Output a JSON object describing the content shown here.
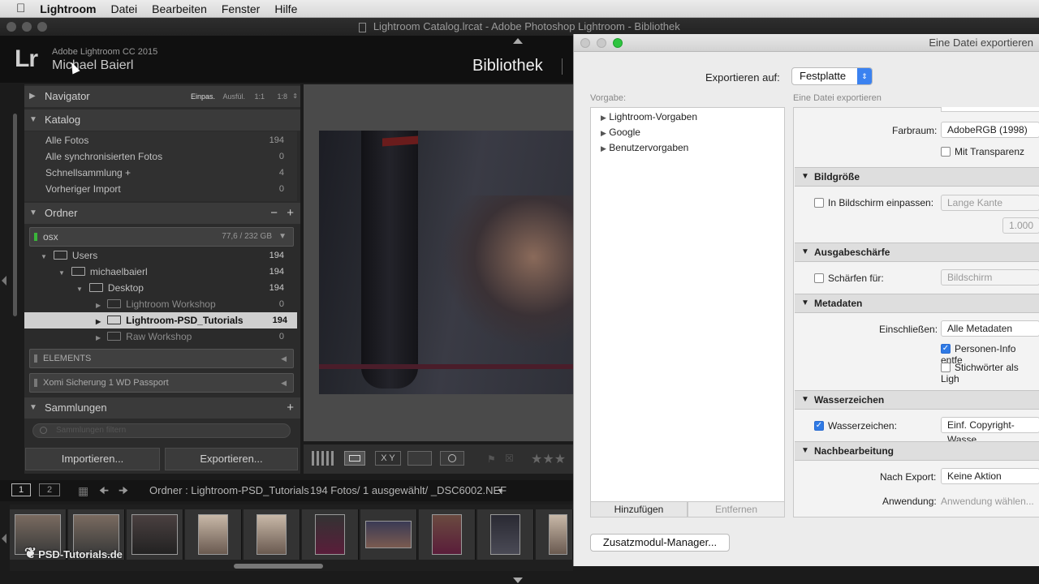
{
  "menubar": {
    "apple": "",
    "app": "Lightroom",
    "items": [
      "Datei",
      "Bearbeiten",
      "Fenster",
      "Hilfe"
    ]
  },
  "window_title": "Lightroom Catalog.lrcat - Adobe Photoshop Lightroom - Bibliothek",
  "identity": {
    "logo": "Lr",
    "product": "Adobe Lightroom CC 2015",
    "user": "Michael Baierl",
    "module": "Bibliothek"
  },
  "navigator": {
    "title": "Navigator",
    "zoom": [
      "Einpas.",
      "Ausfül.",
      "1:1",
      "1:8"
    ]
  },
  "katalog": {
    "title": "Katalog",
    "items": [
      {
        "label": "Alle Fotos",
        "count": "194"
      },
      {
        "label": "Alle synchronisierten Fotos",
        "count": "0"
      },
      {
        "label": "Schnellsammlung +",
        "count": "4"
      },
      {
        "label": "Vorheriger Import",
        "count": "0"
      }
    ]
  },
  "ordner": {
    "title": "Ordner",
    "minus": "−",
    "plus": "+",
    "volume": {
      "name": "osx",
      "info": "77,6 / 232 GB"
    },
    "tree": [
      {
        "label": "Users",
        "count": "194"
      },
      {
        "label": "michaelbaierl",
        "count": "194"
      },
      {
        "label": "Desktop",
        "count": "194"
      },
      {
        "label": "Lightroom Workshop",
        "count": "0"
      },
      {
        "label": "Lightroom-PSD_Tutorials",
        "count": "194"
      },
      {
        "label": "Raw Workshop",
        "count": "0"
      }
    ],
    "volumes2": [
      "ELEMENTS",
      "Xomi Sicherung 1 WD Passport"
    ]
  },
  "sammlungen": {
    "title": "Sammlungen",
    "plus": "+",
    "filter_placeholder": "Sammlungen filtern"
  },
  "buttons": {
    "import": "Importieren...",
    "export": "Exportieren..."
  },
  "filmbar": {
    "page1": "1",
    "page2": "2",
    "path": "Ordner : Lightroom-PSD_Tutorials",
    "info": "194 Fotos/  1 ausgewählt/  _DSC6002.NEF"
  },
  "watermark": "PSD-Tutorials.de",
  "dialog": {
    "title": "Eine Datei exportieren",
    "export_to_label": "Exportieren auf:",
    "export_to_value": "Festplatte",
    "preset_label": "Vorgabe:",
    "presets": [
      "Lightroom-Vorgaben",
      "Google",
      "Benutzervorgaben"
    ],
    "add": "Hinzufügen",
    "remove": "Entfernen",
    "right_header": "Eine Datei exportieren",
    "farbraum_label": "Farbraum:",
    "farbraum_value": "AdobeRGB (1998)",
    "transparenz": "Mit Transparenz",
    "bildgroesse": "Bildgröße",
    "bildschirm_einpassen": "In Bildschirm einpassen:",
    "lange_kante": "Lange Kante",
    "size_value": "1.000",
    "ausgabeschaerfe": "Ausgabeschärfe",
    "schaerfen_fuer": "Schärfen für:",
    "schaerfen_value": "Bildschirm",
    "metadaten": "Metadaten",
    "einschliessen": "Einschließen:",
    "einschliessen_value": "Alle Metadaten",
    "personen": "Personen-Info entfe",
    "stichwoerter": "Stichwörter als Ligh",
    "wasserzeichen": "Wasserzeichen",
    "wasserzeichen_label": "Wasserzeichen:",
    "wasserzeichen_value": "Einf. Copyright-Wasse",
    "nachbearbeitung": "Nachbearbeitung",
    "nach_export": "Nach Export:",
    "nach_export_value": "Keine Aktion",
    "anwendung": "Anwendung:",
    "anwendung_value": "Anwendung wählen...",
    "plugin_manager": "Zusatzmodul-Manager..."
  }
}
